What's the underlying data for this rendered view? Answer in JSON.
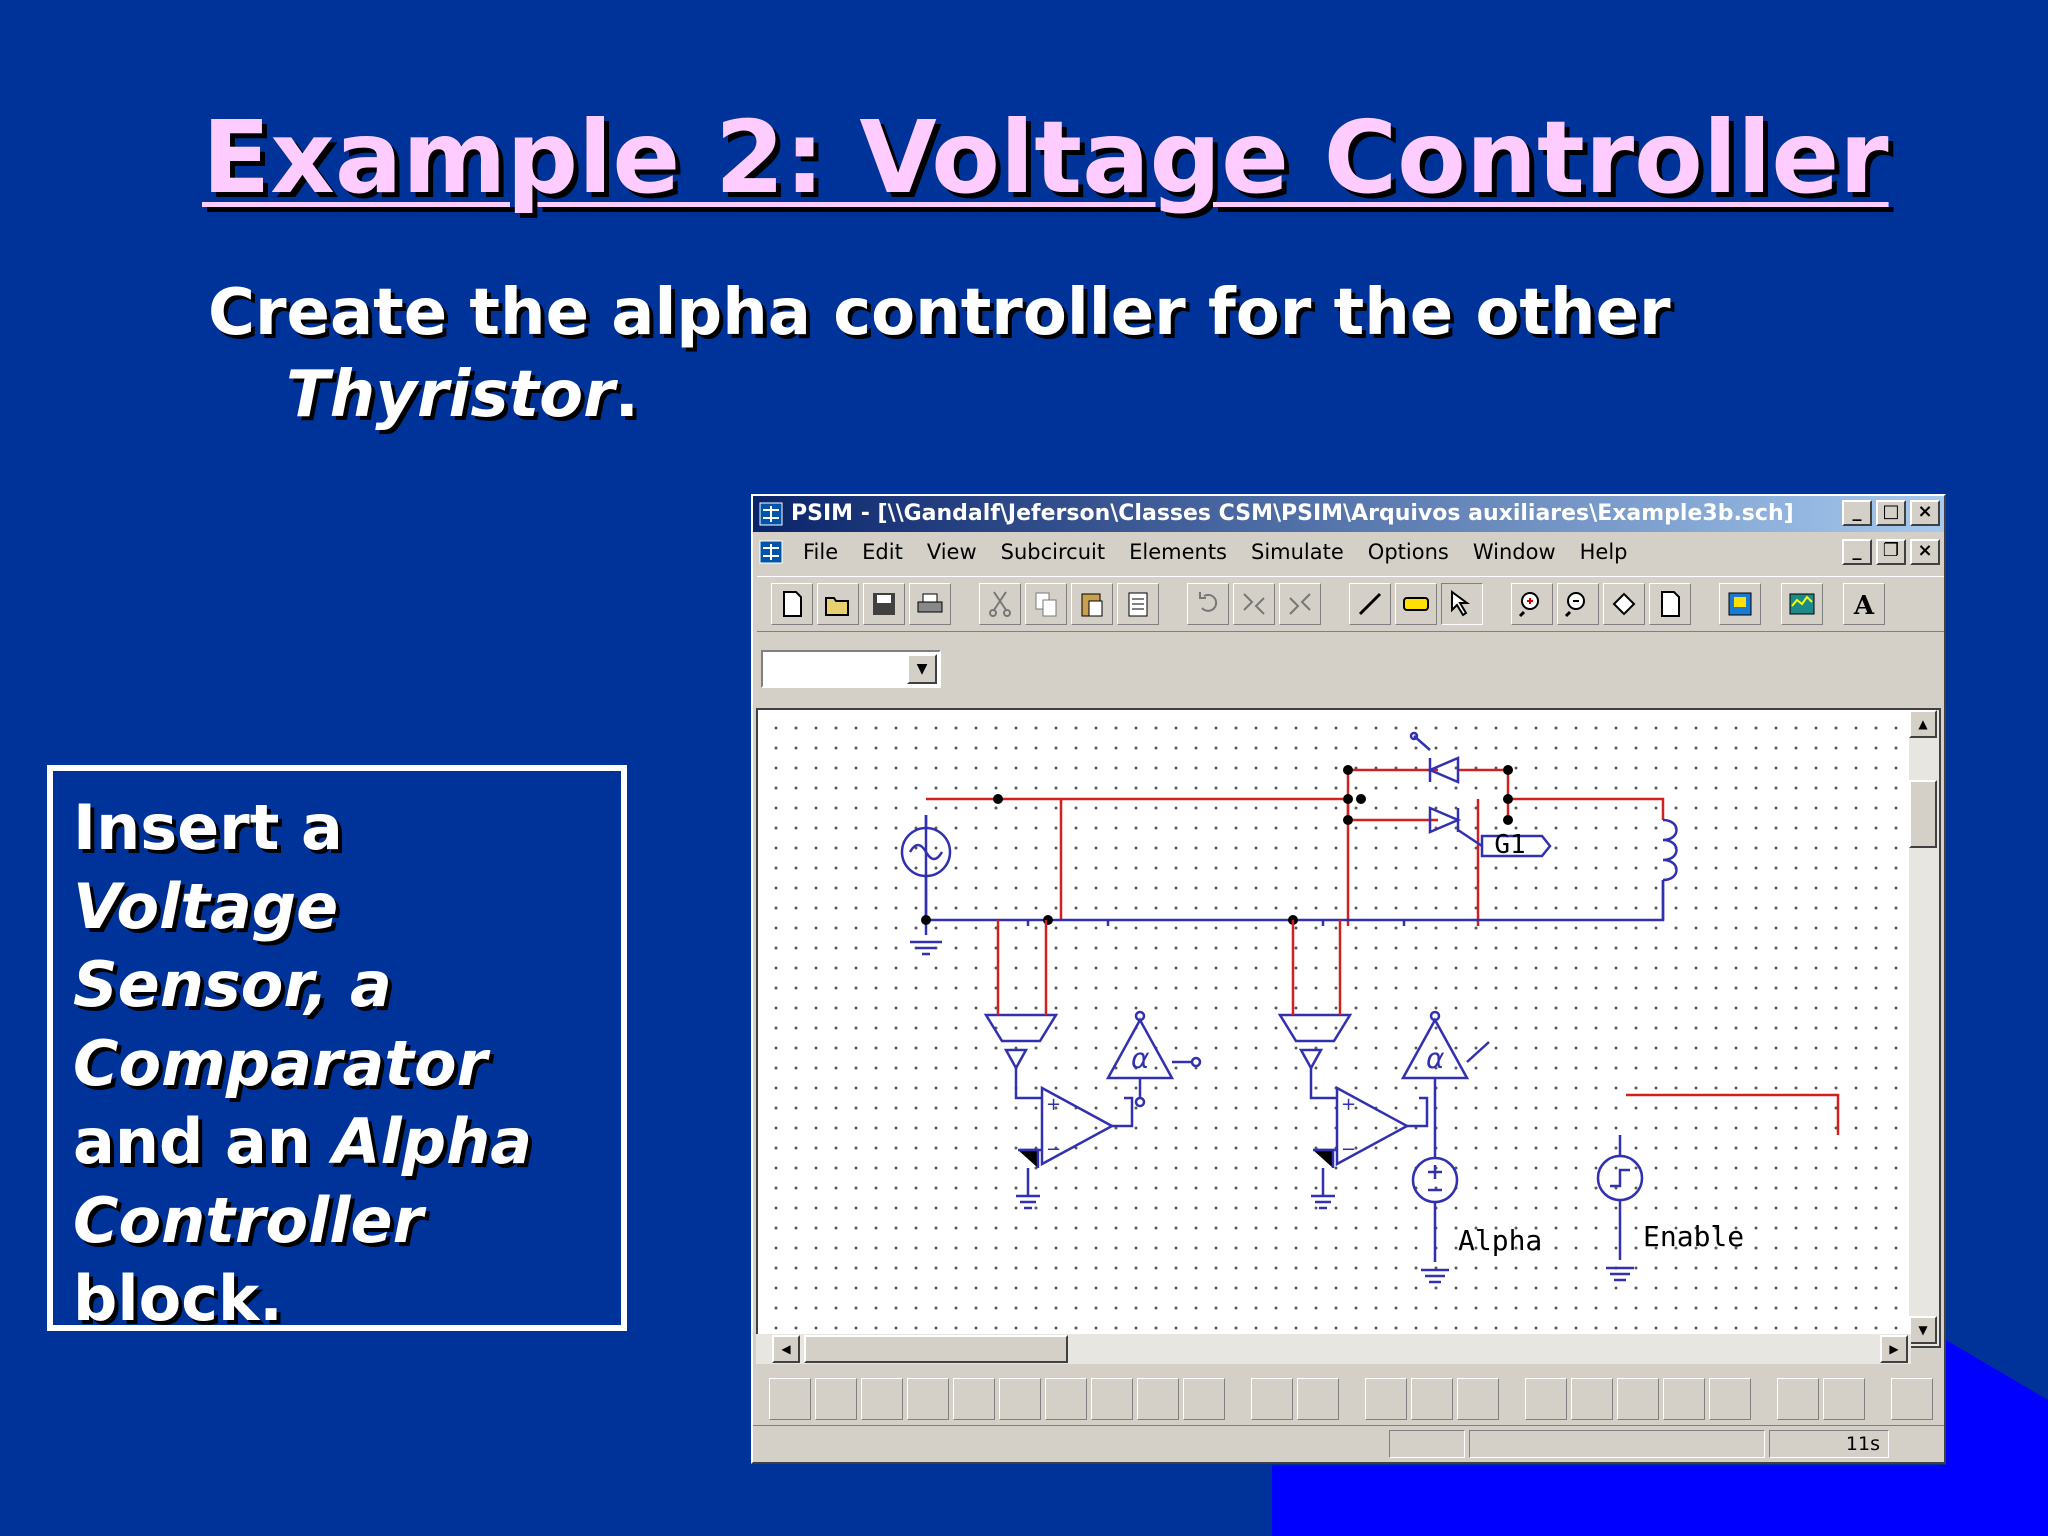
{
  "slide": {
    "title": "Example 2: Voltage Controller",
    "subtitle_line1": "Create the alpha controller for the other",
    "subtitle_italic": "Thyristor",
    "subtitle_end": ".",
    "note": {
      "t1": "Insert a",
      "t2": "Voltage",
      "t3": "Sensor, a",
      "t4": "Comparator",
      "t5": "and an",
      "t6": "Alpha",
      "t7": "Controller",
      "t8": "block."
    },
    "colors": {
      "background": "#003399",
      "title": "#ffccff",
      "accent": "#0000ff"
    }
  },
  "window": {
    "title": "PSIM - [\\\\Gandalf\\Jeferson\\Classes CSM\\PSIM\\Arquivos auxiliares\\Example3b.sch]",
    "menu": [
      "File",
      "Edit",
      "View",
      "Subcircuit",
      "Elements",
      "Simulate",
      "Options",
      "Window",
      "Help"
    ],
    "toolbar_icons": [
      "new-icon",
      "open-icon",
      "save-icon",
      "print-icon",
      "cut-icon",
      "copy-icon",
      "paste-icon",
      "paste-special-icon",
      "rotate-icon",
      "flip-icon",
      "mirror-icon",
      "wire-icon",
      "label-icon",
      "select-icon",
      "zoom-in-icon",
      "zoom-out-icon",
      "zoom-fit-icon",
      "page-icon",
      "simcad-icon",
      "simview-icon",
      "text-icon"
    ],
    "circuit": {
      "g1_label": "G1",
      "alpha_label": "Alpha",
      "enable_label": "Enable"
    },
    "status": {
      "time": "11s"
    }
  }
}
